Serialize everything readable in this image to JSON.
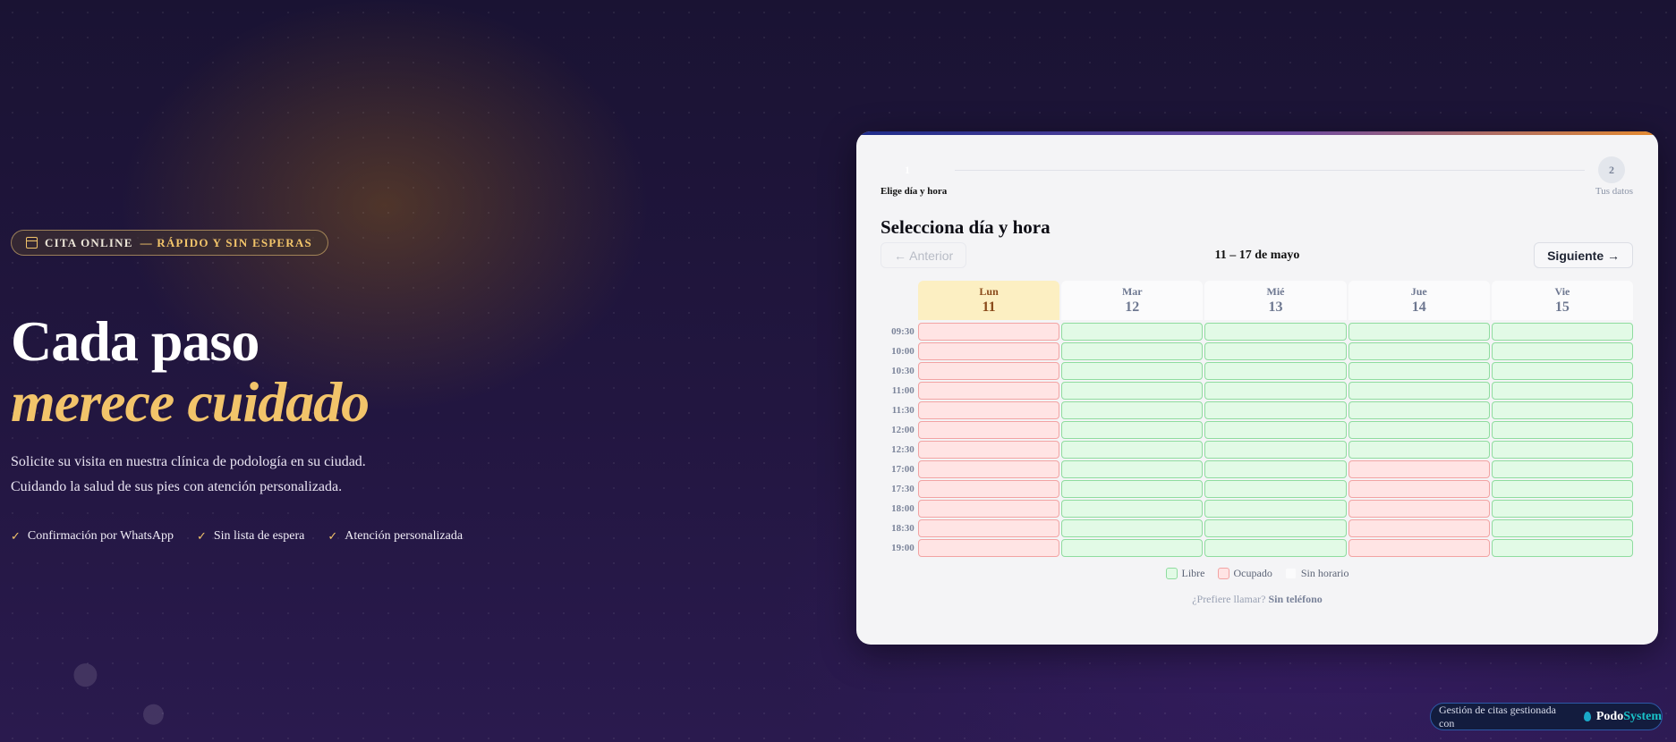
{
  "hero": {
    "badge_main": "CITA ONLINE",
    "badge_accent": "— RÁPIDO Y SIN ESPERAS",
    "title_line1": "Cada paso",
    "title_line2": "merece cuidado",
    "subtitle_line1": "Solicite su visita en nuestra clínica de podología en su ciudad.",
    "subtitle_line2": "Cuidando la salud de sus pies con atención personalizada.",
    "features": [
      "Confirmación por WhatsApp",
      "Sin lista de espera",
      "Atención personalizada"
    ]
  },
  "wizard": {
    "step1_number": "1",
    "step1_label": "Elige día y hora",
    "step2_number": "2",
    "step2_label": "Tus datos"
  },
  "booking": {
    "title": "Selecciona día y hora",
    "prev_label": "← Anterior",
    "next_label": "Siguiente →",
    "range": "11 – 17 de mayo",
    "days": [
      {
        "name": "Lun",
        "num": "11",
        "today": true
      },
      {
        "name": "Mar",
        "num": "12",
        "today": false
      },
      {
        "name": "Mié",
        "num": "13",
        "today": false
      },
      {
        "name": "Jue",
        "num": "14",
        "today": false
      },
      {
        "name": "Vie",
        "num": "15",
        "today": false
      }
    ],
    "times": [
      "09:30",
      "10:00",
      "10:30",
      "11:00",
      "11:30",
      "12:00",
      "12:30",
      "17:00",
      "17:30",
      "18:00",
      "18:30",
      "19:00"
    ],
    "availability": [
      [
        "busy",
        "free",
        "free",
        "free",
        "free"
      ],
      [
        "busy",
        "free",
        "free",
        "free",
        "free"
      ],
      [
        "busy",
        "free",
        "free",
        "free",
        "free"
      ],
      [
        "busy",
        "free",
        "free",
        "free",
        "free"
      ],
      [
        "busy",
        "free",
        "free",
        "free",
        "free"
      ],
      [
        "busy",
        "free",
        "free",
        "free",
        "free"
      ],
      [
        "busy",
        "free",
        "free",
        "free",
        "free"
      ],
      [
        "busy",
        "free",
        "free",
        "busy",
        "free"
      ],
      [
        "busy",
        "free",
        "free",
        "busy",
        "free"
      ],
      [
        "busy",
        "free",
        "free",
        "busy",
        "free"
      ],
      [
        "busy",
        "free",
        "free",
        "busy",
        "free"
      ],
      [
        "busy",
        "free",
        "free",
        "busy",
        "free"
      ]
    ],
    "legend": {
      "free": "Libre",
      "busy": "Ocupado",
      "none": "Sin horario"
    },
    "call_prompt": "¿Prefiere llamar?",
    "call_link": "Sin teléfono"
  },
  "footer": {
    "powered_text": "Gestión de citas gestionada con",
    "brand_part1": "Podo",
    "brand_part2": "System"
  },
  "colors": {
    "accent_gold": "#f2c46a",
    "free_bg": "#e2fae6",
    "busy_bg": "#ffe4e4",
    "brand_teal": "#19c3c9"
  }
}
